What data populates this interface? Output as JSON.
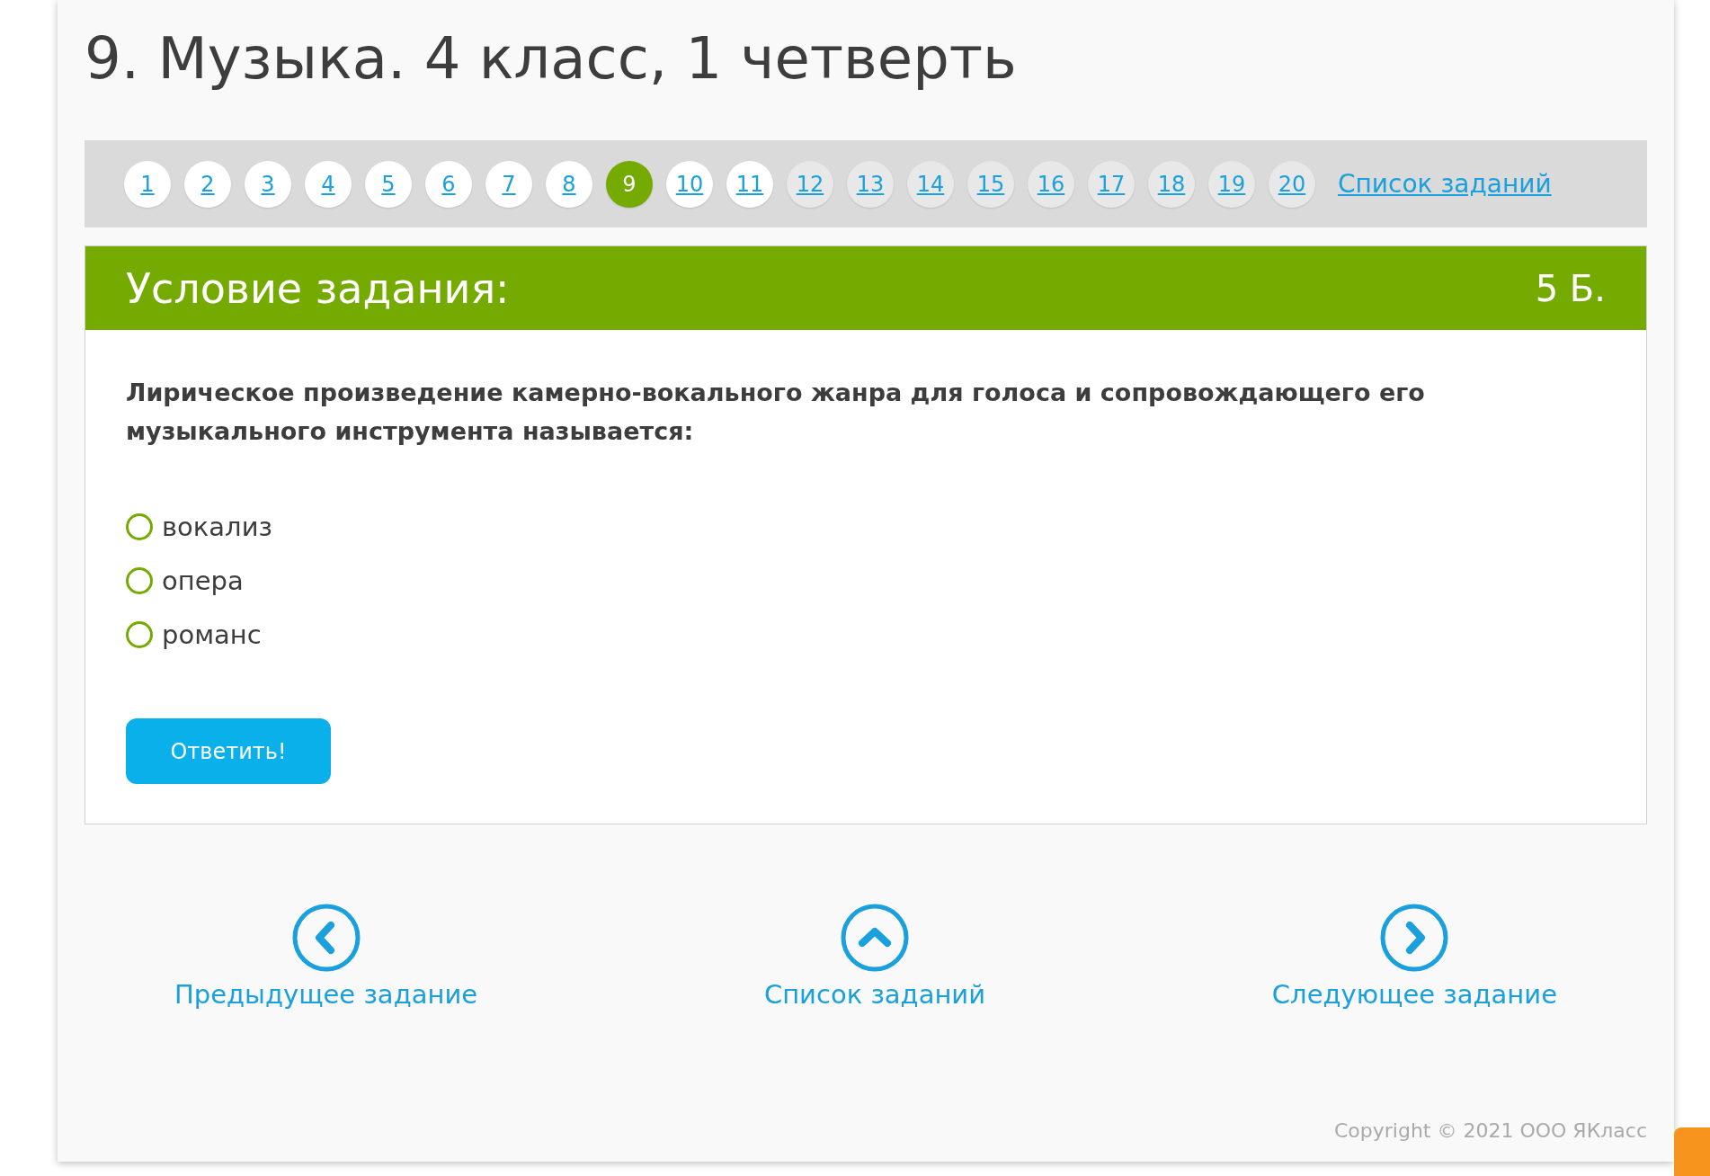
{
  "title": "9. Музыка. 4 класс, 1 четверть",
  "pagination": {
    "pages": [
      {
        "label": "1",
        "visited": true,
        "selected": false
      },
      {
        "label": "2",
        "visited": true,
        "selected": false
      },
      {
        "label": "3",
        "visited": true,
        "selected": false
      },
      {
        "label": "4",
        "visited": true,
        "selected": false
      },
      {
        "label": "5",
        "visited": true,
        "selected": false
      },
      {
        "label": "6",
        "visited": true,
        "selected": false
      },
      {
        "label": "7",
        "visited": true,
        "selected": false
      },
      {
        "label": "8",
        "visited": true,
        "selected": false
      },
      {
        "label": "9",
        "visited": true,
        "selected": true
      },
      {
        "label": "10",
        "visited": true,
        "selected": false
      },
      {
        "label": "11",
        "visited": true,
        "selected": false
      },
      {
        "label": "12",
        "visited": false,
        "selected": false
      },
      {
        "label": "13",
        "visited": false,
        "selected": false
      },
      {
        "label": "14",
        "visited": false,
        "selected": false
      },
      {
        "label": "15",
        "visited": false,
        "selected": false
      },
      {
        "label": "16",
        "visited": false,
        "selected": false
      },
      {
        "label": "17",
        "visited": false,
        "selected": false
      },
      {
        "label": "18",
        "visited": false,
        "selected": false
      },
      {
        "label": "19",
        "visited": false,
        "selected": false
      },
      {
        "label": "20",
        "visited": false,
        "selected": false
      }
    ],
    "list_link": "Список заданий"
  },
  "task": {
    "header": "Условие задания:",
    "points": "5 Б.",
    "question": "Лирическое произведение камерно-вокального жанра для голоса и сопровождающего его музыкального инструмента называется:",
    "options": [
      {
        "label": "вокализ",
        "selected": false
      },
      {
        "label": "опера",
        "selected": false
      },
      {
        "label": "романс",
        "selected": false
      }
    ],
    "submit": "Ответить!"
  },
  "navigation": [
    {
      "kind": "prev",
      "label": "Предыдущее задание"
    },
    {
      "kind": "up",
      "label": "Список заданий"
    },
    {
      "kind": "next",
      "label": "Следующее задание"
    }
  ],
  "footer": {
    "copyright": "Copyright © 2021 ООО ЯКласс"
  }
}
